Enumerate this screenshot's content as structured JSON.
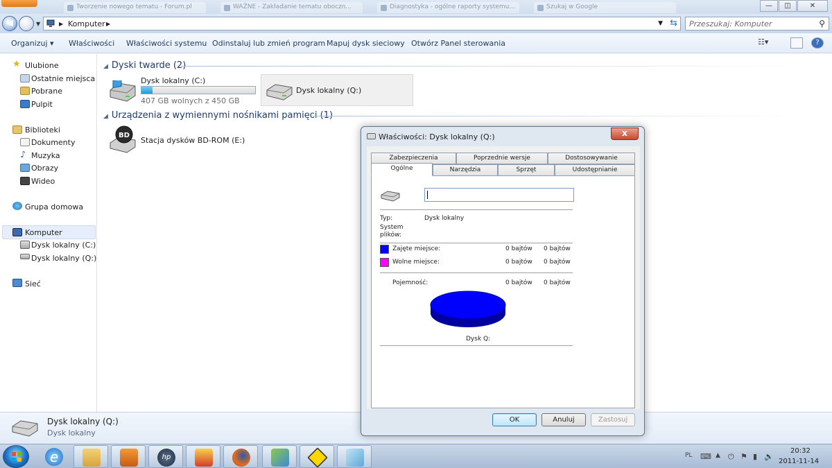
{
  "browser_tabs": [
    "Tworzenie nowego tematu - Forum.pl",
    "WAŻNE - Zakładanie tematu oboczn...",
    "Diagnostyka - ogólne raporty systemu...",
    "Szukaj w Google"
  ],
  "window": {
    "minimize": "—",
    "maximize": "◫",
    "close": "✕"
  },
  "address": {
    "path": "Komputer",
    "search_placeholder": "Przeszukaj: Komputer"
  },
  "toolbar": {
    "organize": "Organizuj ▾",
    "properties": "Właściwości",
    "system_properties": "Właściwości systemu",
    "uninstall": "Odinstaluj lub zmień program",
    "map_drive": "Mapuj dysk sieciowy",
    "control_panel": "Otwórz Panel sterowania"
  },
  "nav": {
    "favorites": "Ulubione",
    "recent": "Ostatnie miejsca",
    "downloads": "Pobrane",
    "desktop": "Pulpit",
    "libraries": "Biblioteki",
    "documents": "Dokumenty",
    "music": "Muzyka",
    "pictures": "Obrazy",
    "videos": "Wideo",
    "homegroup": "Grupa domowa",
    "computer": "Komputer",
    "drive_c": "Dysk lokalny (C:)",
    "drive_q": "Dysk lokalny (Q:)",
    "network": "Sieć"
  },
  "content": {
    "hard_disks_header": "Dyski twarde (2)",
    "drive_c": {
      "name": "Dysk lokalny (C:)",
      "space": "407 GB wolnych z 450 GB",
      "used_fraction": 0.096
    },
    "drive_q": {
      "name": "Dysk lokalny (Q:)"
    },
    "removable_header": "Urządzenia z wymiennymi nośnikami pamięci (1)",
    "bd_drive": {
      "name": "Stacja dysków BD-ROM (E:)",
      "badge": "BD"
    }
  },
  "details": {
    "name": "Dysk lokalny (Q:)",
    "type": "Dysk lokalny"
  },
  "dialog": {
    "title": "Właściwości: Dysk lokalny (Q:)",
    "close": "x",
    "tabs_row1": [
      "Zabezpieczenia",
      "Poprzednie wersje",
      "Dostosowywanie"
    ],
    "tabs_row2": [
      "Ogólne",
      "Narzędzia",
      "Sprzęt",
      "Udostępnianie"
    ],
    "name_value": "",
    "type_label": "Typ:",
    "type_value": "Dysk lokalny",
    "fs_label": "System\nplików:",
    "used_label": "Zajęte miejsce:",
    "used_bytes": "0 bajtów",
    "used_size": "0 bajtów",
    "free_label": "Wolne miejsce:",
    "free_bytes": "0 bajtów",
    "free_size": "0 bajtów",
    "capacity_label": "Pojemność:",
    "capacity_bytes": "0 bajtów",
    "capacity_size": "0 bajtów",
    "disk_label": "Dysk Q:",
    "used_color": "#0000ff",
    "free_color": "#ff00ff",
    "ok": "OK",
    "cancel": "Anuluj",
    "apply": "Zastosuj"
  },
  "taskbar": {
    "apps": [
      "windows-explorer",
      "media-player",
      "hp",
      "avira",
      "firefox",
      "paint",
      "game",
      "notepad"
    ],
    "lang": "PL",
    "time": "20:32",
    "date": "2011-11-14"
  }
}
